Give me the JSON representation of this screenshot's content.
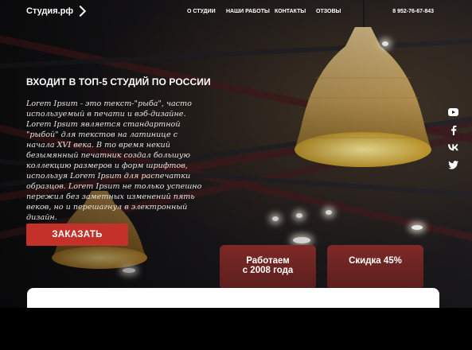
{
  "header": {
    "logo_text": "Студия.рф",
    "nav": [
      "О СТУДИИ",
      "НАШИ РАБОТЫ",
      "КОНТАКТЫ",
      "ОТЗОВЫ"
    ],
    "phone": "8 952-76-67-843"
  },
  "hero": {
    "headline": "ВХОДИТ В ТОП-5 СТУДИЙ ПО РОССИИ",
    "description": "Lorem Ipsum - это текст-\"рыба\", часто используемый в печати и вэб-дизайне. Lorem Ipsum является стандартной \"рыбой\" для текстов на латинице с начала XVI века. В то время некий безымянный печатник создал большую коллекцию размеров и форм шрифтов, используя Lorem Ipsum для распечатки образцов. Lorem Ipsum не только успешно пережил без заметных изменений пять веков, но и перешагнул в электронный дизайн.",
    "order_button": "ЗАКАЗАТЬ"
  },
  "cards": [
    {
      "line1": "Работаем",
      "line2": "с 2008 года"
    },
    {
      "line1": "Скидка 45%",
      "line2": ""
    }
  ],
  "social": [
    "youtube-icon",
    "facebook-icon",
    "vk-icon",
    "twitter-icon"
  ],
  "colors": {
    "accent": "#c2322a",
    "card": "#6e2422",
    "text": "#ffffff"
  }
}
